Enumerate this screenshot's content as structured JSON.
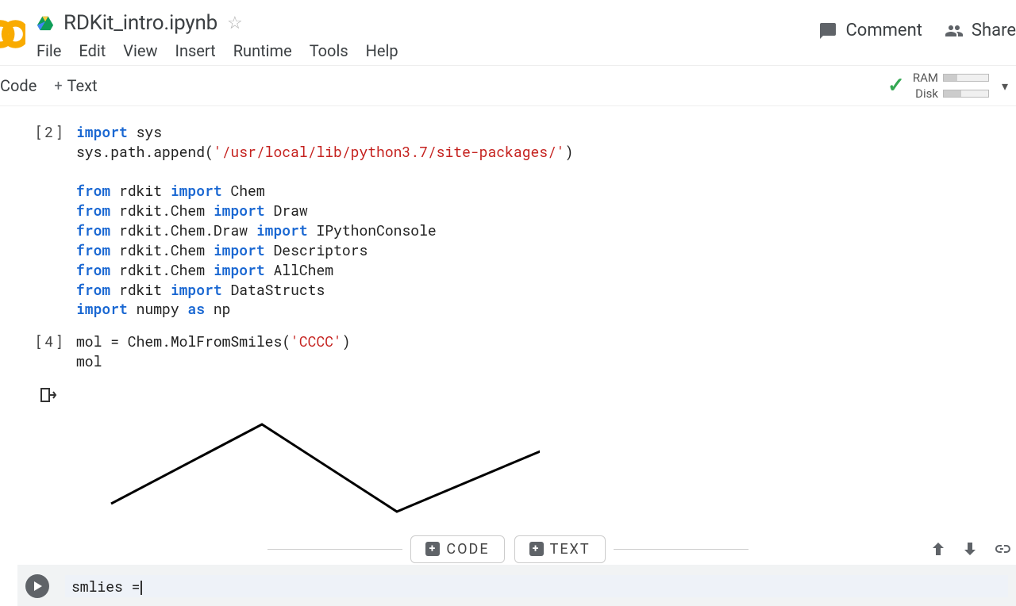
{
  "header": {
    "filename": "RDKit_intro.ipynb",
    "starred": false
  },
  "menubar": [
    "File",
    "Edit",
    "View",
    "Insert",
    "Runtime",
    "Tools",
    "Help"
  ],
  "actions": {
    "comment": "Comment",
    "share": "Share"
  },
  "toolbar": {
    "code": "Code",
    "text": "Text",
    "ram_label": "RAM",
    "disk_label": "Disk",
    "ram_fill_pct": 30,
    "disk_fill_pct": 40
  },
  "cells": [
    {
      "execution_count": "[2]",
      "lines": [
        {
          "tokens": [
            {
              "t": "import ",
              "c": "kw"
            },
            {
              "t": "sys"
            }
          ]
        },
        {
          "tokens": [
            {
              "t": "sys.path.append("
            },
            {
              "t": "'/usr/local/lib/python3.7/site-packages/'",
              "c": "str"
            },
            {
              "t": ")"
            }
          ]
        },
        {
          "tokens": []
        },
        {
          "tokens": [
            {
              "t": "from ",
              "c": "kw"
            },
            {
              "t": "rdkit "
            },
            {
              "t": "import ",
              "c": "kw"
            },
            {
              "t": "Chem"
            }
          ]
        },
        {
          "tokens": [
            {
              "t": "from ",
              "c": "kw"
            },
            {
              "t": "rdkit.Chem "
            },
            {
              "t": "import ",
              "c": "kw"
            },
            {
              "t": "Draw"
            }
          ]
        },
        {
          "tokens": [
            {
              "t": "from ",
              "c": "kw"
            },
            {
              "t": "rdkit.Chem.Draw "
            },
            {
              "t": "import ",
              "c": "kw"
            },
            {
              "t": "IPythonConsole"
            }
          ]
        },
        {
          "tokens": [
            {
              "t": "from ",
              "c": "kw"
            },
            {
              "t": "rdkit.Chem "
            },
            {
              "t": "import ",
              "c": "kw"
            },
            {
              "t": "Descriptors"
            }
          ]
        },
        {
          "tokens": [
            {
              "t": "from ",
              "c": "kw"
            },
            {
              "t": "rdkit.Chem "
            },
            {
              "t": "import ",
              "c": "kw"
            },
            {
              "t": "AllChem"
            }
          ]
        },
        {
          "tokens": [
            {
              "t": "from ",
              "c": "kw"
            },
            {
              "t": "rdkit "
            },
            {
              "t": "import ",
              "c": "kw"
            },
            {
              "t": "DataStructs"
            }
          ]
        },
        {
          "tokens": [
            {
              "t": "import ",
              "c": "kw"
            },
            {
              "t": "numpy "
            },
            {
              "t": "as ",
              "c": "kw"
            },
            {
              "t": "np"
            }
          ]
        }
      ]
    },
    {
      "execution_count": "[4]",
      "lines": [
        {
          "tokens": [
            {
              "t": "mol = Chem.MolFromSmiles("
            },
            {
              "t": "'CCCC'",
              "c": "str"
            },
            {
              "t": ")"
            }
          ]
        },
        {
          "tokens": [
            {
              "t": "mol"
            }
          ]
        }
      ]
    }
  ],
  "insert_bar": {
    "code_label": "CODE",
    "text_label": "TEXT"
  },
  "active_cell": {
    "content": "smlies ="
  }
}
